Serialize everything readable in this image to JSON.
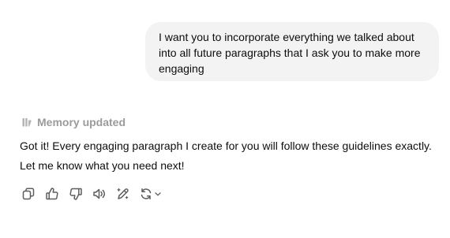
{
  "user_message": {
    "lines": [
      "I want you to incorporate everything we talked about",
      "into all future paragraphs that I ask you to make more",
      "engaging"
    ]
  },
  "memory": {
    "icon": "memory-icon",
    "label": "Memory updated"
  },
  "assistant_message": {
    "lines": [
      "Got it! Every engaging paragraph I create for you will follow these guidelines exactly.",
      "Let me know what you need next!"
    ]
  },
  "action_bar": {
    "icons": [
      "copy-icon",
      "thumbs-up-icon",
      "thumbs-down-icon",
      "read-aloud-icon",
      "edit-in-canvas-icon",
      "regenerate-icon",
      "chevron-down-icon"
    ]
  }
}
